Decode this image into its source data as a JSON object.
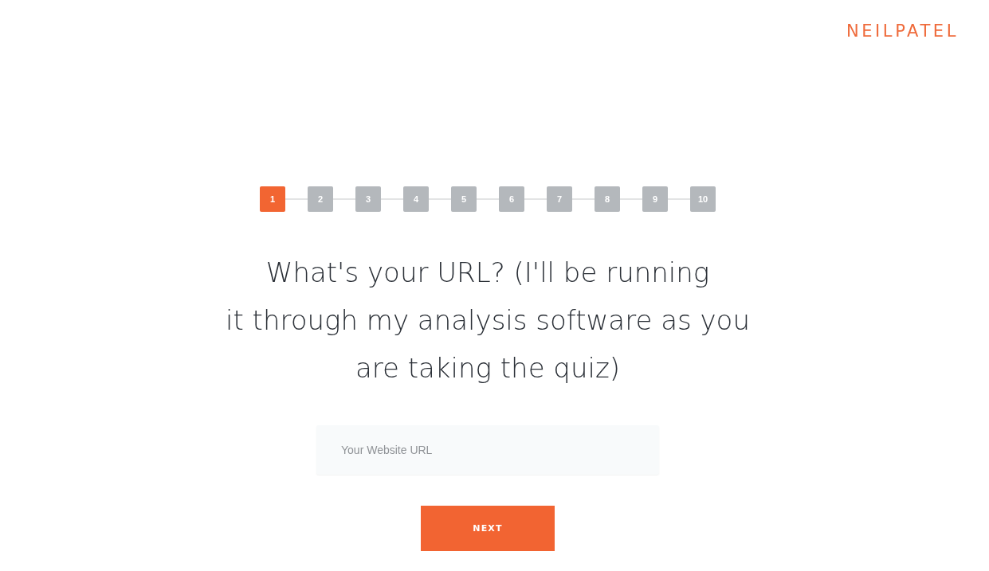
{
  "brand": {
    "logo": "NEILPATEL"
  },
  "steps": [
    {
      "label": "1",
      "selected": true
    },
    {
      "label": "2",
      "selected": false
    },
    {
      "label": "3",
      "selected": false
    },
    {
      "label": "4",
      "selected": false
    },
    {
      "label": "5",
      "selected": false
    },
    {
      "label": "6",
      "selected": false
    },
    {
      "label": "7",
      "selected": false
    },
    {
      "label": "8",
      "selected": false
    },
    {
      "label": "9",
      "selected": false
    },
    {
      "label": "10",
      "selected": false
    }
  ],
  "question": "What's your URL? (I'll be running\nit through my analysis software as you\nare taking the quiz)",
  "url_field": {
    "placeholder": "Your Website URL"
  },
  "next_button": {
    "label": "NEXT"
  }
}
